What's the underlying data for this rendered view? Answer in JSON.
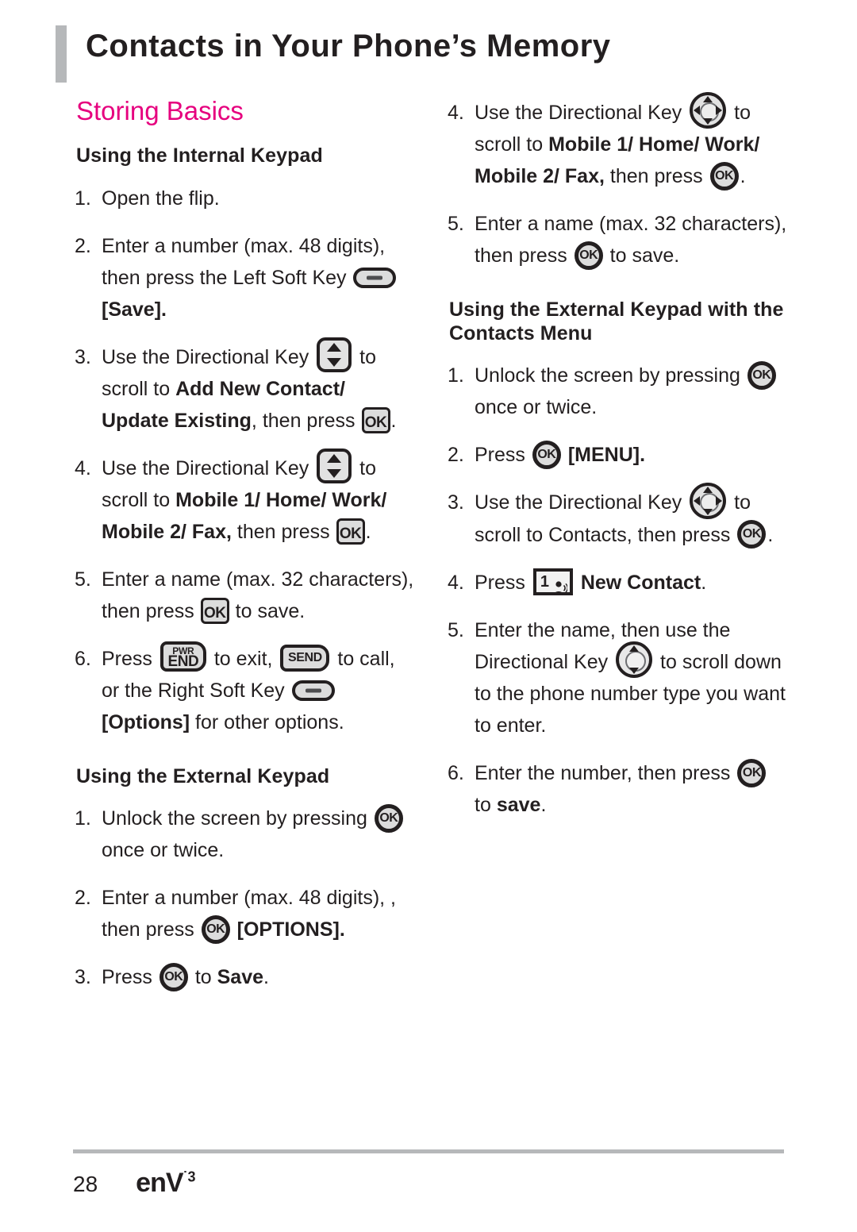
{
  "header": {
    "title": "Contacts in Your Phone’s Memory"
  },
  "left_column": {
    "section_heading": "Storing Basics",
    "sub_heading_1": "Using the Internal Keypad",
    "steps_internal": [
      {
        "num": "1.",
        "parts": [
          "Open the flip."
        ]
      },
      {
        "num": "2.",
        "parts": [
          "Enter a number (max. 48 digits), then press the Left Soft Key ",
          "[Save]."
        ]
      },
      {
        "num": "3.",
        "parts": [
          "Use the Directional Key ",
          " to scroll to ",
          "Add New Contact/ Update Existing",
          ", then press ",
          "."
        ]
      },
      {
        "num": "4.",
        "parts": [
          "Use the Directional Key ",
          " to scroll to ",
          "Mobile 1/ Home/ Work/ Mobile 2/ Fax,",
          " then press ",
          "."
        ]
      },
      {
        "num": "5.",
        "parts": [
          "Enter a name (max. 32 characters), then press ",
          " to save."
        ]
      },
      {
        "num": "6.",
        "parts": [
          "Press ",
          " to exit, ",
          " to call, or the Right Soft Key ",
          "[Options]",
          " for other options."
        ]
      }
    ],
    "sub_heading_2": "Using the External Keypad",
    "steps_external": [
      {
        "num": "1.",
        "parts": [
          "Unlock the screen by pressing ",
          " once or twice."
        ]
      },
      {
        "num": "2.",
        "parts": [
          "Enter a number (max. 48 digits), then press ",
          "[OPTIONS]."
        ]
      },
      {
        "num": "3.",
        "parts": [
          "Press ",
          " to ",
          "Save",
          "."
        ]
      }
    ]
  },
  "right_column": {
    "steps_internal_cont": [
      {
        "num": "4.",
        "parts": [
          "Use the Directional Key ",
          " to scroll to ",
          "Mobile 1/ Home/ Work/ Mobile 2/ Fax,",
          " then press ",
          "."
        ]
      },
      {
        "num": "5.",
        "parts": [
          "Enter a name (max. 32 characters), then press ",
          " to save."
        ]
      }
    ],
    "sub_heading": "Using the External Keypad with the Contacts Menu",
    "steps_contacts_menu": [
      {
        "num": "1.",
        "parts": [
          "Unlock the screen by pressing ",
          " once or twice."
        ]
      },
      {
        "num": "2.",
        "parts": [
          "Press ",
          "[MENU]."
        ]
      },
      {
        "num": "3.",
        "parts": [
          "Use the Directional Key ",
          " to scroll to Contacts, then press ",
          "."
        ]
      },
      {
        "num": "4.",
        "parts": [
          "Press ",
          "New Contact",
          "."
        ]
      },
      {
        "num": "5.",
        "parts": [
          "Enter the name, then use the Directional Key ",
          " to scroll down to the phone number type you want to enter."
        ]
      },
      {
        "num": "6.",
        "parts": [
          "Enter the number, then press ",
          " to ",
          "save",
          "."
        ]
      }
    ]
  },
  "icons": {
    "ok_label": "OK",
    "pwr_label": "PWR",
    "end_label": "END",
    "send_label": "SEND",
    "num1_label": "1"
  },
  "text": {
    "step1_open_flip": "Open the flip.",
    "step2_enter_number_48": "Enter a number (max. 48 digits),",
    "step2_then_press_lsk": "then press the Left Soft Key",
    "step2_save_bracket": "[Save].",
    "use_directional_key": "Use the Directional Key",
    "to": "to",
    "scroll_to": "scroll to",
    "add_new_contact": "Add New Contact/",
    "update_existing": "Update Existing",
    "then_press": ", then press",
    "period": ".",
    "mobile1_home": "Mobile 1/ Home/",
    "work_mobile2_fax": "Work/ Mobile 2/ Fax,",
    "then": "then",
    "press": "press",
    "enter_name_32": "Enter a name (max. 32",
    "characters_then_press": "characters), then press",
    "to_save_word": "to",
    "save_lower": "save.",
    "press_word": "Press",
    "to_exit": "to exit,",
    "to_call": "to call,",
    "or_right_soft_key": "or the Right Soft Key",
    "options_bracket": "[Options]",
    "for_other_options": "for other options.",
    "unlock_screen": "Unlock the screen by pressing",
    "once_or_twice": "once or twice.",
    "options_caps": "[OPTIONS].",
    "to_save_bold": "to",
    "save_bold": "Save",
    "menu_caps": "[MENU].",
    "scroll_contacts": "scroll to Contacts, then press",
    "new_contact": "New Contact",
    "enter_name_then_use": "Enter the name, then use the",
    "directional_key": "Directional Key",
    "to_scroll": "to scroll",
    "down_phone_number": "down to the phone number",
    "type_you_want": "type you want to enter.",
    "enter_number_then_press": "Enter the number, then press",
    "save_word_bold": "save"
  },
  "footer": {
    "page_number": "28",
    "brand": "enV",
    "brand_sup": "˙3"
  },
  "colors": {
    "accent_pink": "#e6007e",
    "text": "#231f20",
    "rule_gray": "#b6b8ba",
    "key_fill": "#dcdcdc"
  }
}
